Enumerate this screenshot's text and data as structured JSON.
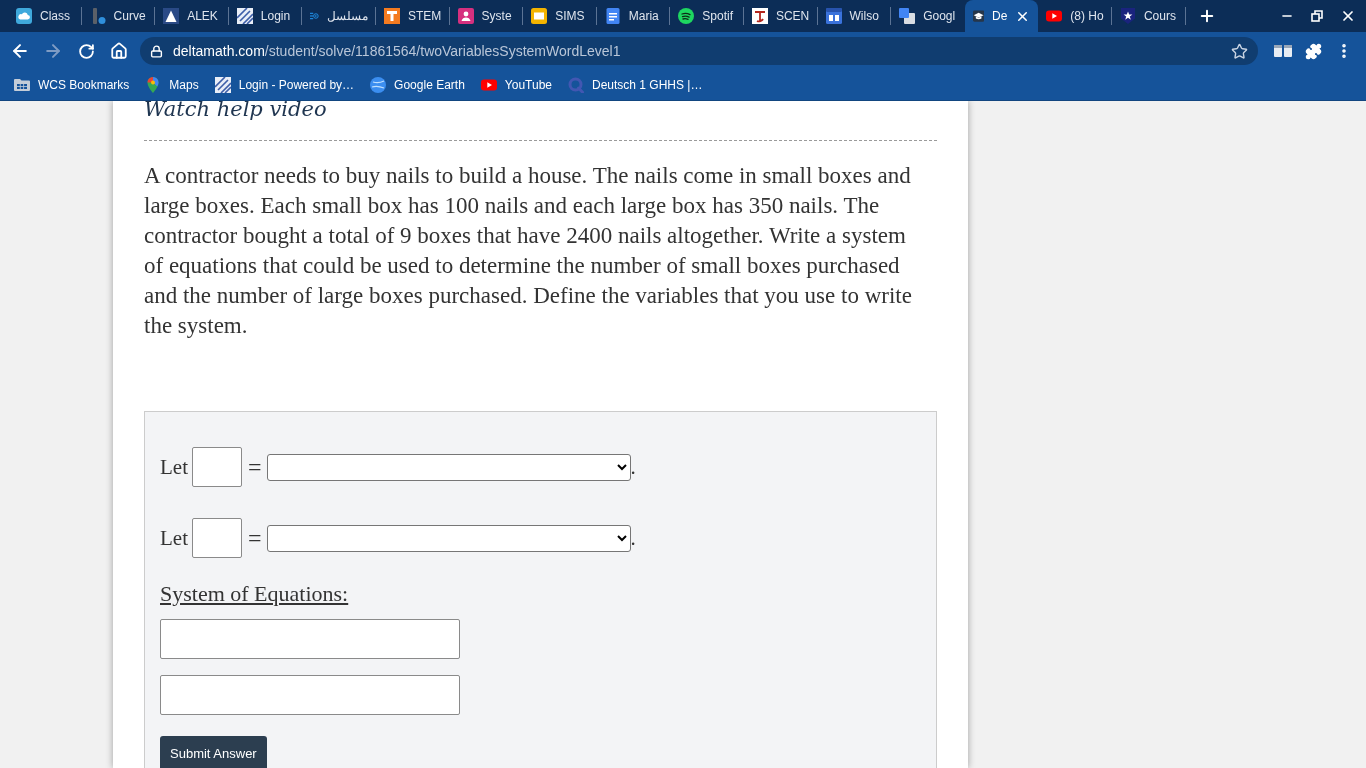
{
  "tab_strip": {
    "tabs": [
      {
        "title": "Class",
        "kind": "cloud",
        "selected": false
      },
      {
        "title": "Curve",
        "kind": "mark",
        "selected": false
      },
      {
        "title": "ALEK",
        "kind": "triangle",
        "selected": false
      },
      {
        "title": "Login",
        "kind": "stripes",
        "selected": false
      },
      {
        "title": "مسلسل",
        "kind": "video",
        "selected": false
      },
      {
        "title": "STEM",
        "kind": "tile",
        "selected": false
      },
      {
        "title": "Syste",
        "kind": "person",
        "selected": false
      },
      {
        "title": "SIMS",
        "kind": "slides",
        "selected": false
      },
      {
        "title": "Maria",
        "kind": "doc",
        "selected": false
      },
      {
        "title": "Spotif",
        "kind": "waves",
        "selected": false
      },
      {
        "title": "SCEN",
        "kind": "emblem",
        "selected": false
      },
      {
        "title": "Wilso",
        "kind": "calendar",
        "selected": false
      },
      {
        "title": "Googl",
        "kind": "translate",
        "selected": false
      },
      {
        "title": "De",
        "kind": "cap",
        "selected": true
      },
      {
        "title": "(8) Ho",
        "kind": "play",
        "selected": false
      },
      {
        "title": "Cours",
        "kind": "shield",
        "selected": false
      }
    ]
  },
  "toolbar": {
    "url": {
      "domain": "deltamath.com",
      "path": "/student/solve/11861564/twoVariablesSystemWordLevel1"
    }
  },
  "bookmarks": [
    {
      "label": "WCS Bookmarks",
      "kind": "folder"
    },
    {
      "label": "Maps",
      "kind": "pin"
    },
    {
      "label": "Login - Powered by…",
      "kind": "stripes"
    },
    {
      "label": "Google Earth",
      "kind": "globe"
    },
    {
      "label": "YouTube",
      "kind": "play"
    },
    {
      "label": "Deutsch 1 GHHS |…",
      "kind": "ring"
    }
  ],
  "page": {
    "help_link": "Watch help video",
    "problem": "A contractor needs to buy nails to build a house. The nails come in small boxes and large boxes. Each small box has 100 nails and each large box has 350 nails. The contractor bought a total of 9 boxes that have 2400 nails altogether. Write a system of equations that could be used to determine the number of small boxes purchased and the number of large boxes purchased. Define the variables that you use to write the system.",
    "variables": [
      {
        "label": "Let",
        "relation": "=",
        "end": "."
      },
      {
        "label": "Let",
        "relation": "=",
        "end": "."
      }
    ],
    "system_heading": "System of Equations:",
    "equations": [
      {
        "kind": "text"
      },
      {
        "kind": "text"
      }
    ],
    "submit_button": "Submit Answer"
  }
}
